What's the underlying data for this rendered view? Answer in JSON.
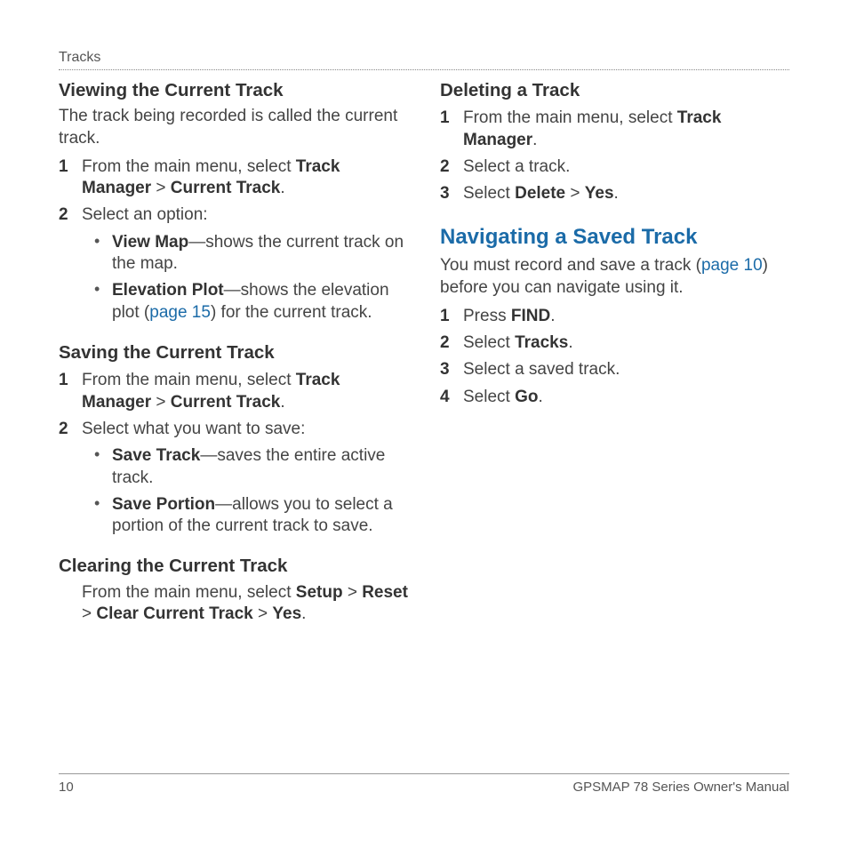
{
  "runningHead": "Tracks",
  "left": {
    "h1": "Viewing the Current Track",
    "p1": "The track being recorded is called the current track.",
    "s1a_pre": "From the main menu, select ",
    "s1a_b1": "Track Manager",
    "s1a_gt": " > ",
    "s1a_b2": "Current Track",
    "s1a_post": ".",
    "s1b": "Select an option:",
    "b1_b": "View Map",
    "b1_t": "—shows the current track on the map.",
    "b2_b": "Elevation Plot",
    "b2_t1": "—shows the elevation plot (",
    "b2_link": "page 15",
    "b2_t2": ") for the current track.",
    "h2": "Saving the Current Track",
    "s2a_pre": "From the main menu, select ",
    "s2a_b1": "Track Manager",
    "s2a_gt": " > ",
    "s2a_b2": "Current Track",
    "s2a_post": ".",
    "s2b": "Select what you want to save:",
    "b3_b": "Save Track",
    "b3_t": "—saves the entire active track.",
    "b4_b": "Save Portion",
    "b4_t": "—allows you to select a portion of the current track to save.",
    "h3": "Clearing the Current Track",
    "clr_pre": "From the main menu, select ",
    "clr_b1": "Setup",
    "clr_gt1": " > ",
    "clr_b2": "Reset",
    "clr_gt2": " > ",
    "clr_b3": "Clear Current Track",
    "clr_gt3": " > ",
    "clr_b4": "Yes",
    "clr_post": "."
  },
  "right": {
    "h1": "Deleting a Track",
    "d1_pre": "From the main menu, select ",
    "d1_b": "Track Manager",
    "d1_post": ".",
    "d2": "Select a track.",
    "d3_pre": "Select ",
    "d3_b1": "Delete",
    "d3_gt": " > ",
    "d3_b2": "Yes",
    "d3_post": ".",
    "h2": "Navigating a Saved Track",
    "nav_p1a": "You must record and save a track (",
    "nav_link": "page 10",
    "nav_p1b": ") before you can navigate using it.",
    "n1_pre": "Press ",
    "n1_b": "FIND",
    "n1_post": ".",
    "n2_pre": "Select ",
    "n2_b": "Tracks",
    "n2_post": ".",
    "n3": "Select a saved track.",
    "n4_pre": "Select ",
    "n4_b": "Go",
    "n4_post": "."
  },
  "footer": {
    "pageNum": "10",
    "title": "GPSMAP 78 Series Owner's Manual"
  }
}
